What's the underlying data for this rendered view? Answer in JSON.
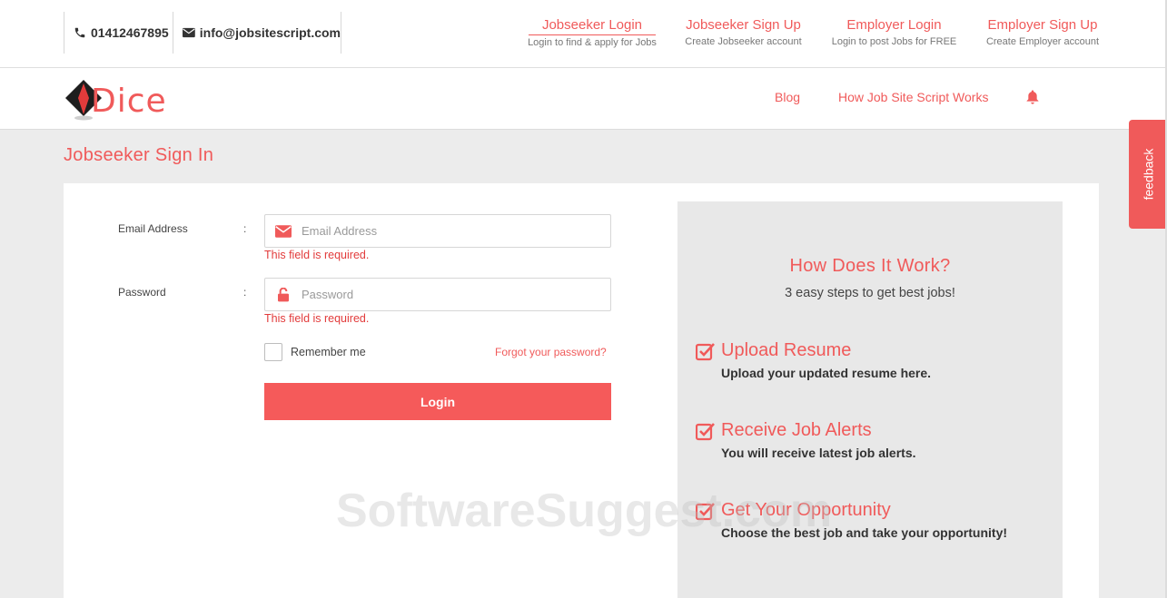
{
  "contact": {
    "phone": "01412467895",
    "email": "info@jobsitescript.com"
  },
  "auth_links": [
    {
      "title": "Jobseeker Login",
      "subtitle": "Login to find & apply for Jobs"
    },
    {
      "title": "Jobseeker Sign Up",
      "subtitle": "Create Jobseeker account"
    },
    {
      "title": "Employer Login",
      "subtitle": "Login to post Jobs for FREE"
    },
    {
      "title": "Employer Sign Up",
      "subtitle": "Create Employer account"
    }
  ],
  "logo": {
    "text": "Dice"
  },
  "nav": {
    "blog": "Blog",
    "how": "How Job Site Script Works"
  },
  "page_title": "Jobseeker Sign In",
  "form": {
    "email_label": "Email Address",
    "email_placeholder": "Email Address",
    "email_error": "This field is required.",
    "password_label": "Password",
    "password_placeholder": "Password",
    "password_error": "This field is required.",
    "colon": ":",
    "remember_label": "Remember me",
    "forgot_label": "Forgot your password?",
    "login_label": "Login"
  },
  "how": {
    "title": "How Does It Work?",
    "subtitle": "3 easy steps to get best jobs!",
    "steps": [
      {
        "title": "Upload Resume",
        "desc": "Upload your updated resume here."
      },
      {
        "title": "Receive Job Alerts",
        "desc": "You will receive latest job alerts."
      },
      {
        "title": "Get Your Opportunity",
        "desc": "Choose the best job and take your opportunity!"
      }
    ]
  },
  "feedback_label": "feedback",
  "watermark": "SoftwareSuggest.com",
  "colors": {
    "accent": "#f05a5a",
    "button": "#f55a5a",
    "error": "#e23b3b"
  }
}
